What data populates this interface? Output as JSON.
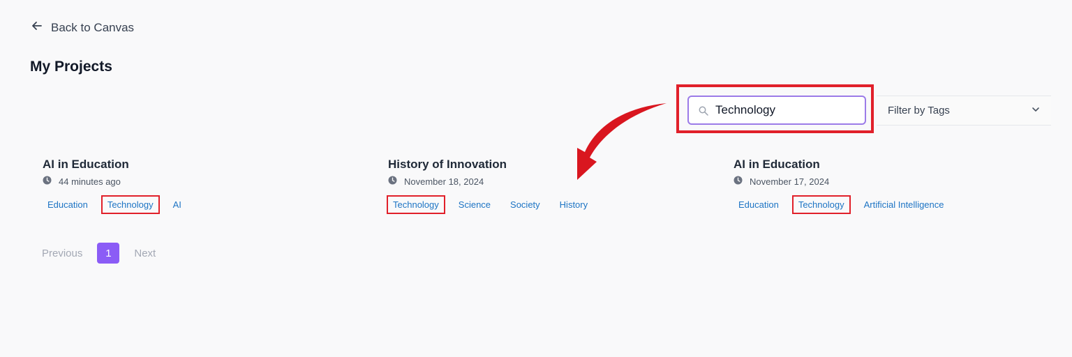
{
  "nav": {
    "back_label": "Back to Canvas"
  },
  "page": {
    "title": "My Projects"
  },
  "search": {
    "value": "Technology",
    "placeholder": ""
  },
  "filter": {
    "label": "Filter by Tags"
  },
  "projects": [
    {
      "title": "AI in Education",
      "time": "44 minutes ago",
      "tags": [
        "Education",
        "Technology",
        "AI"
      ]
    },
    {
      "title": "History of Innovation",
      "time": "November 18, 2024",
      "tags": [
        "Technology",
        "Science",
        "Society",
        "History"
      ]
    },
    {
      "title": "AI in Education",
      "time": "November 17, 2024",
      "tags": [
        "Education",
        "Technology",
        "Artificial Intelligence"
      ]
    }
  ],
  "pagination": {
    "previous": "Previous",
    "current": "1",
    "next": "Next"
  },
  "colors": {
    "accent": "#8b5cf6",
    "annotation": "#e1202a",
    "tag": "#1d74c4"
  }
}
